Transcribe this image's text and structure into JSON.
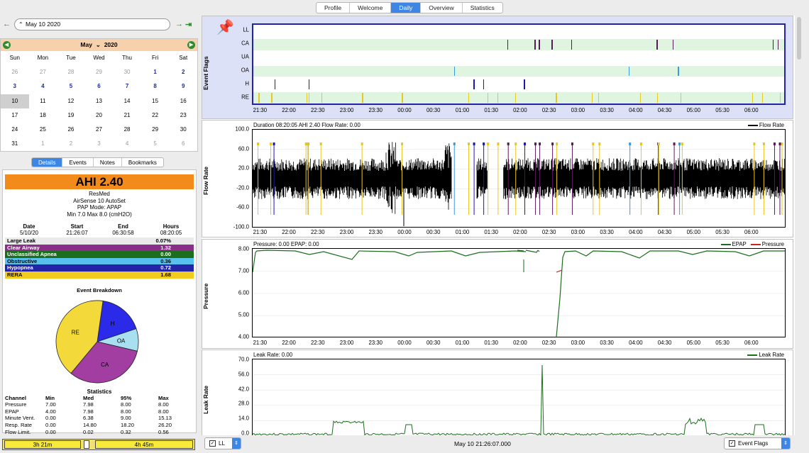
{
  "tabs": [
    "Profile",
    "Welcome",
    "Daily",
    "Overview",
    "Statistics"
  ],
  "active_tab": "Daily",
  "date_field": "May 10 2020",
  "calendar": {
    "month": "May",
    "year": "2020",
    "weekdays": [
      "Sun",
      "Mon",
      "Tue",
      "Wed",
      "Thu",
      "Fri",
      "Sat"
    ],
    "weeks": [
      [
        "26",
        "27",
        "28",
        "29",
        "30",
        "1",
        "2"
      ],
      [
        "3",
        "4",
        "5",
        "6",
        "7",
        "8",
        "9"
      ],
      [
        "10",
        "11",
        "12",
        "13",
        "14",
        "15",
        "16"
      ],
      [
        "17",
        "18",
        "19",
        "20",
        "21",
        "22",
        "23"
      ],
      [
        "24",
        "25",
        "26",
        "27",
        "28",
        "29",
        "30"
      ],
      [
        "31",
        "1",
        "2",
        "3",
        "4",
        "5",
        "6"
      ]
    ],
    "selected": "10"
  },
  "detail_tabs": [
    "Details",
    "Events",
    "Notes",
    "Bookmarks"
  ],
  "ahi": "AHI 2.40",
  "device": [
    "ResMed",
    "AirSense 10 AutoSet",
    "PAP Mode: APAP",
    "Min 7.0 Max 8.0 (cmH2O)"
  ],
  "session": {
    "headers": [
      "Date",
      "Start",
      "End",
      "Hours"
    ],
    "values": [
      "5/10/20",
      "21:26:07",
      "06:30:58",
      "08:20:05"
    ]
  },
  "event_table": [
    {
      "name": "Large Leak",
      "value": "0.07%",
      "color": "#eaeaea"
    },
    {
      "name": "Clear Airway",
      "value": "1.32",
      "color": "#8a2e8a"
    },
    {
      "name": "Unclassified Apnea",
      "value": "0.00",
      "color": "#1c6e1c"
    },
    {
      "name": "Obstructive",
      "value": "0.36",
      "color": "#57c0ec"
    },
    {
      "name": "Hypopnea",
      "value": "0.72",
      "color": "#2424a8"
    },
    {
      "name": "RERA",
      "value": "1.68",
      "color": "#f0cc1c"
    }
  ],
  "breakdown_title": "Event Breakdown",
  "breakdown": [
    {
      "label": "H",
      "value": 0.72,
      "color": "#2a2ae8"
    },
    {
      "label": "OA",
      "value": 0.36,
      "color": "#a8e0f2"
    },
    {
      "label": "CA",
      "value": 1.32,
      "color": "#a23ea2"
    },
    {
      "label": "RE",
      "value": 1.68,
      "color": "#f3da3a"
    }
  ],
  "stats_title": "Statistics",
  "stats": {
    "headers": [
      "Channel",
      "Min",
      "Med",
      "95%",
      "Max"
    ],
    "rows": [
      [
        "Pressure",
        "7.00",
        "7.98",
        "8.00",
        "8.00"
      ],
      [
        "EPAP",
        "4.00",
        "7.98",
        "8.00",
        "8.00"
      ],
      [
        "Minute Vent.",
        "0.00",
        "6.38",
        "9.00",
        "15.13"
      ],
      [
        "Resp. Rate",
        "0.00",
        "14.80",
        "18.20",
        "26.20"
      ],
      [
        "Flow Limit.",
        "0.00",
        "0.02",
        "0.32",
        "0.56"
      ]
    ]
  },
  "time_range": {
    "left": "3h 21m",
    "right": "4h 45m"
  },
  "x_ticks": [
    "21:30",
    "22:00",
    "22:30",
    "23:00",
    "23:30",
    "00:00",
    "00:30",
    "01:00",
    "01:30",
    "02:00",
    "02:30",
    "03:00",
    "03:30",
    "04:00",
    "04:30",
    "05:00",
    "05:30",
    "06:00"
  ],
  "event_flags": {
    "ylabel": "Event Flags",
    "rows": [
      "LL",
      "CA",
      "UA",
      "OA",
      "H",
      "RE"
    ],
    "row_colors": [
      "#ffffff",
      "#dff5df",
      "#ffffff",
      "#dff5df",
      "#ffffff",
      "#dff5df"
    ],
    "marks": {
      "CA": [
        0.479,
        0.53,
        0.538,
        0.562,
        0.599,
        0.76,
        0.79,
        0.978,
        0.988
      ],
      "OA": [
        0.378,
        0.707,
        0.8
      ],
      "H": [
        0.04,
        0.104,
        0.415,
        0.433,
        0.51
      ],
      "RE": [
        0.01,
        0.034,
        0.1,
        0.104,
        0.128,
        0.205,
        0.28,
        0.405,
        0.441,
        0.46,
        0.493,
        0.57,
        0.638,
        0.65,
        0.728,
        0.761,
        0.805,
        0.94,
        0.958,
        0.992
      ]
    },
    "mark_colors": {
      "CA": "#5a1a5a",
      "OA": "#3a9ae0",
      "H": "#1a1ab0",
      "RE": "#e8c820"
    }
  },
  "flow": {
    "ylabel": "Flow Rate",
    "title": "Duration 08:20:05 AHI 2.40 Flow Rate: 0.00",
    "legend": "Flow Rate",
    "yticks": [
      "100.0",
      "60.0",
      "20.0",
      "-20.0",
      "-60.0",
      "-100.0"
    ]
  },
  "pressure": {
    "ylabel": "Pressure",
    "title": "Pressure: 0.00 EPAP: 0.00",
    "legend": [
      "EPAP",
      "Pressure"
    ],
    "yticks": [
      "8.00",
      "7.00",
      "6.00",
      "5.00",
      "4.00"
    ],
    "colors": {
      "epap": "#1c6e1c",
      "pressure": "#cc2222"
    }
  },
  "leak": {
    "ylabel": "Leak Rate",
    "title": "Leak Rate: 0.00",
    "legend": "Leak Rate",
    "yticks": [
      "70.0",
      "56.0",
      "42.0",
      "28.0",
      "14.0",
      "0.0"
    ]
  },
  "bottom": {
    "left_select": "LL",
    "center_time": "May 10 21:26:07.000",
    "right_select": "Event Flags"
  }
}
